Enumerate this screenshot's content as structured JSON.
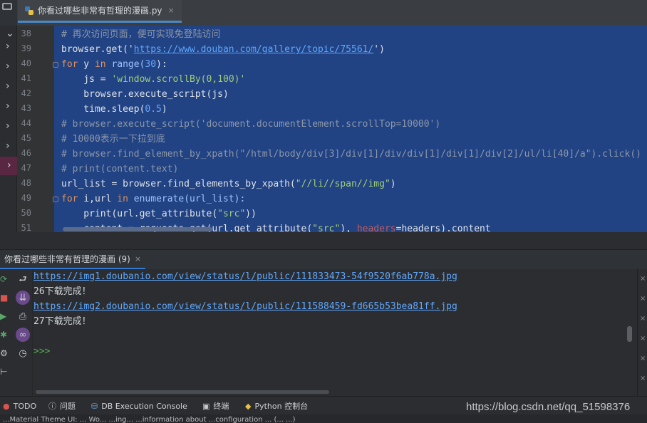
{
  "editor": {
    "tab_label": "你看过哪些非常有哲理的漫画.py",
    "tab_close": "×",
    "line_numbers": [
      "38",
      "39",
      "40",
      "41",
      "42",
      "43",
      "44",
      "45",
      "46",
      "47",
      "48",
      "49",
      "50",
      "51"
    ]
  },
  "code": {
    "l38": "# 再次访问页面，便可实现免登陆访问",
    "l39_a": "browser.get('",
    "l39_url": "https://www.douban.com/gallery/topic/75561/",
    "l39_b": "')",
    "l40_kw": "for",
    "l40_a": " y ",
    "l40_in": "in",
    "l40_b": " range(",
    "l40_num": "30",
    "l40_c": "):",
    "l41_a": "    js = ",
    "l41_str": "'window.scrollBy(0,100)'",
    "l42": "    browser.execute_script(js)",
    "l43_a": "    time.sleep(",
    "l43_num": "0.5",
    "l43_b": ")",
    "l44": "# browser.execute_script('document.documentElement.scrollTop=10000')",
    "l45": "# 10000表示一下拉到底",
    "l46": "# browser.find_element_by_xpath(\"/html/body/div[3]/div[1]/div/div[1]/div[1]/div[2]/ul/li[40]/a\").click()",
    "l47": "# print(content.text)",
    "l48_a": "url_list = browser.find_elements_by_xpath(",
    "l48_str": "\"//li//span//img\"",
    "l48_b": ")",
    "l49_kw": "for",
    "l49_a": " i,url ",
    "l49_in": "in",
    "l49_b": " enumerate(url_list):",
    "l50_a": "    print(url.get_attribute(",
    "l50_str": "\"src\"",
    "l50_b": "))",
    "l51_a": "    content = requests.get(url.get_attribute(",
    "l51_str": "\"src\"",
    "l51_b": "), ",
    "l51_kw": "headers",
    "l51_c": "=headers).content"
  },
  "run": {
    "tab_label": "你看过哪些非常有哲理的漫画 (9)",
    "tab_close": "×",
    "output": [
      {
        "text": "https://img1.doubanio.com/view/status/l/public/111833473-54f9520f6ab778a.jpg",
        "kind": "link"
      },
      {
        "text": "26下载完成！",
        "kind": "text"
      },
      {
        "text": "https://img2.doubanio.com/view/status/l/public/111588459-fd665b53bea81ff.jpg",
        "kind": "link"
      },
      {
        "text": "27下载完成！",
        "kind": "text"
      },
      {
        "text": "",
        "kind": "text"
      },
      {
        "text": ">>>",
        "kind": "prompt"
      }
    ]
  },
  "bottombar": {
    "todo": "TODO",
    "problems": "问题",
    "db_console": "DB Execution Console",
    "terminal": "终端",
    "python_console": "Python 控制台"
  },
  "watermark": "https://blog.csdn.net/qq_51598376",
  "statusbar": "...Material Theme UI: ... Wo... ...ing... ...information about ...configuration ... (... ...)"
}
